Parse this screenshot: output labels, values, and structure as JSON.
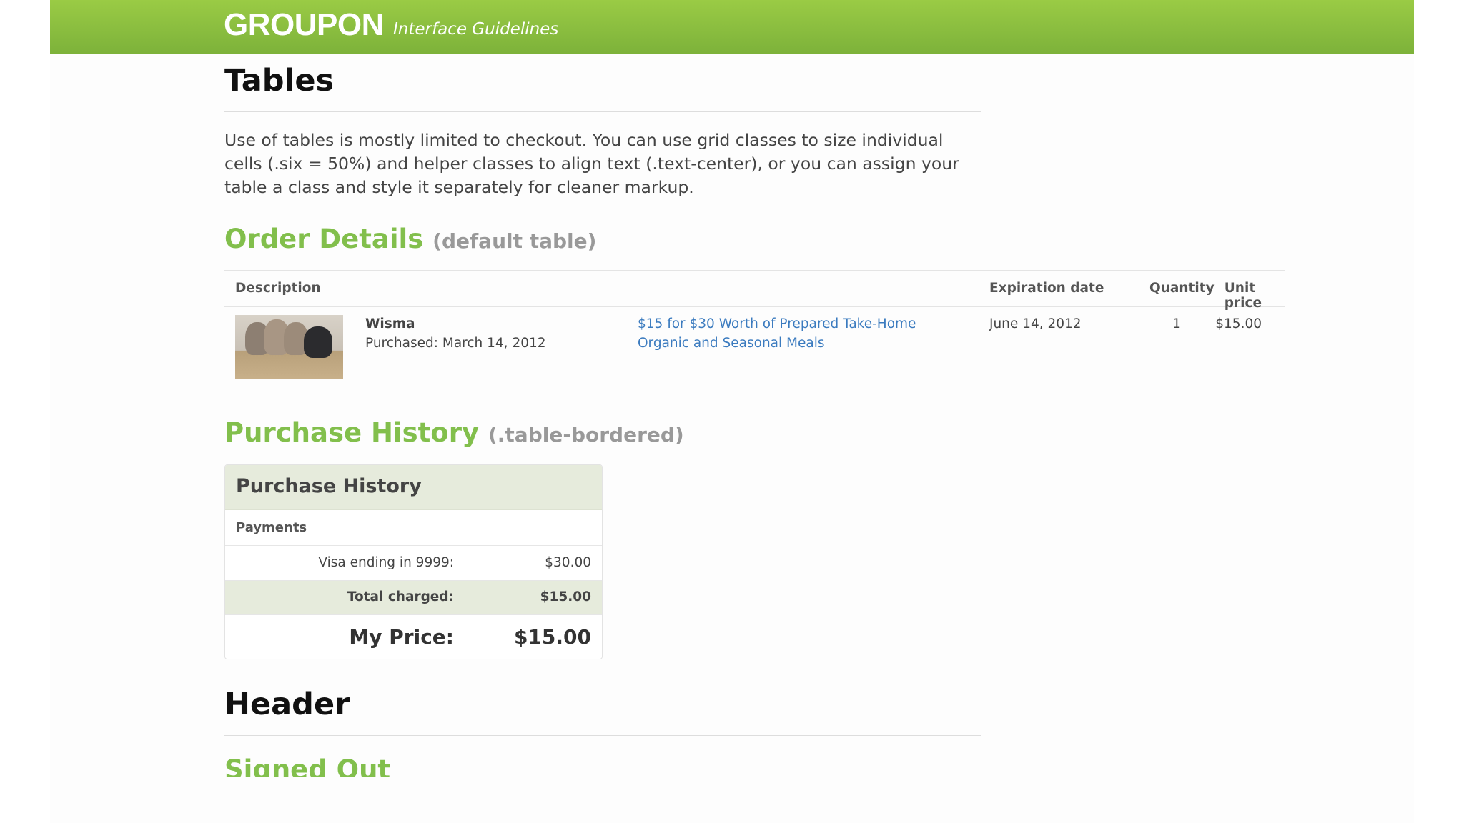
{
  "banner": {
    "logo": "GROUPON",
    "subtitle": "Interface Guidelines",
    "color": "#8dc140"
  },
  "tables_section": {
    "title": "Tables",
    "intro": "Use of tables is mostly limited to checkout. You can use grid classes to size individual cells (.six = 50%) and helper classes to align text (.text-center), or you can assign your table a class and style it separately for cleaner markup."
  },
  "order_details": {
    "title": "Order Details",
    "subtitle": "(default table)",
    "headers": [
      "Description",
      "Expiration date",
      "Quantity",
      "Unit price"
    ],
    "row": {
      "image_name": "kittens-image",
      "merchant": "Wisma",
      "purchased": "Purchased: March 14, 2012",
      "deal_link": "$15 for $30 Worth of Prepared Take-Home Organic and Seasonal Meals",
      "expiration": "June 14, 2012",
      "quantity": "1",
      "unit_price": "$15.00"
    }
  },
  "purchase_history": {
    "title": "Purchase History",
    "subtitle": "(.table-bordered)",
    "box_title": "Purchase History",
    "payments_label": "Payments",
    "visa_label": "Visa ending in 9999:",
    "visa_value": "$30.00",
    "total_label": "Total charged:",
    "total_value": "$15.00",
    "my_price_label": "My Price:",
    "my_price_value": "$15.00",
    "highlight_color": "#e6ebdc"
  },
  "header_section": {
    "title": "Header",
    "signed_out": "Signed Out"
  },
  "colors": {
    "accent_green": "#82bf4c",
    "link_blue": "#3b7bbf"
  }
}
